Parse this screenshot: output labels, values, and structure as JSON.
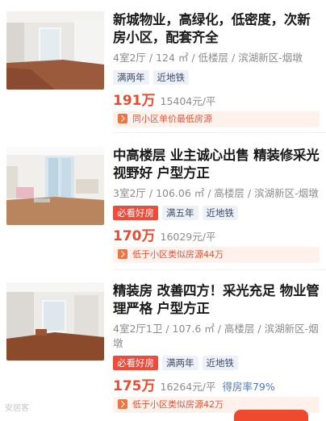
{
  "listings": [
    {
      "title": "新城物业，高绿化，低密度，次新房小区，配套齐全",
      "meta": "4室2厅 / 124 ㎡ / 低楼层 / 滨湖新区-烟墩",
      "tags": [
        "满两年",
        "近地铁"
      ],
      "price": "191万",
      "unit_price": "15404元/平",
      "notice": "同小区单价最低房源"
    },
    {
      "title": "中高楼层 业主诚心出售 精装修采光视野好 户型方正",
      "meta": "3室2厅 / 106.06 ㎡ / 高楼层 / 滨湖新区-烟墩",
      "hot_tag": "必看好房",
      "tags": [
        "满五年",
        "近地铁"
      ],
      "price": "170万",
      "unit_price": "16029元/平",
      "notice": "低于小区类似房源44万"
    },
    {
      "title": "精装房 改善四方！采光充足 物业管理严格 户型方正",
      "meta": "4室2厅1卫 / 107.6 ㎡ / 高楼层 / 滨湖新区-烟墩",
      "hot_tag": "必看好房",
      "tags": [
        "满两年",
        "近地铁"
      ],
      "price": "175万",
      "unit_price": "16264元/平",
      "rate": "得房率79%",
      "notice": "低于小区类似房源42万"
    }
  ],
  "watermark": "安居客",
  "colors": {
    "accent": "#f04a2e",
    "notice_bg": "#fff1ec",
    "tag_bg": "#eef2f8"
  }
}
